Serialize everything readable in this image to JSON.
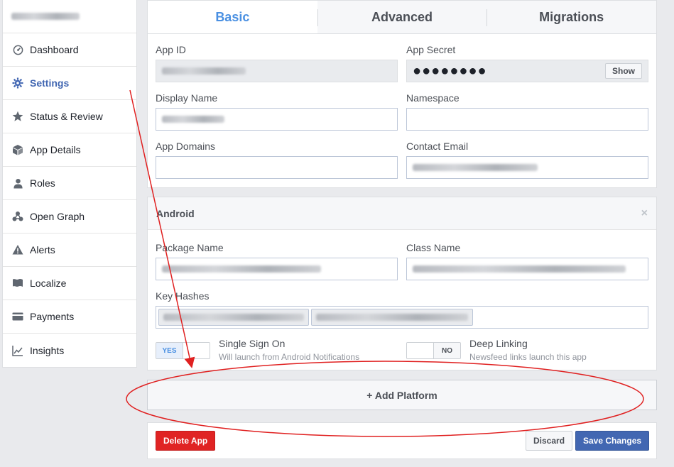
{
  "sidebar": {
    "items": [
      {
        "label": "Dashboard",
        "icon": "dashboard-icon"
      },
      {
        "label": "Settings",
        "icon": "gear-icon",
        "active": true
      },
      {
        "label": "Status & Review",
        "icon": "star-icon"
      },
      {
        "label": "App Details",
        "icon": "cube-icon"
      },
      {
        "label": "Roles",
        "icon": "person-icon"
      },
      {
        "label": "Open Graph",
        "icon": "graph-icon"
      },
      {
        "label": "Alerts",
        "icon": "warning-icon"
      },
      {
        "label": "Localize",
        "icon": "flag-icon"
      },
      {
        "label": "Payments",
        "icon": "card-icon"
      },
      {
        "label": "Insights",
        "icon": "chart-icon"
      }
    ]
  },
  "tabs": [
    {
      "label": "Basic",
      "active": true
    },
    {
      "label": "Advanced"
    },
    {
      "label": "Migrations"
    }
  ],
  "basic": {
    "app_id_label": "App ID",
    "app_secret_label": "App Secret",
    "app_secret_value": "●●●●●●●●",
    "show_label": "Show",
    "display_name_label": "Display Name",
    "namespace_label": "Namespace",
    "app_domains_label": "App Domains",
    "contact_email_label": "Contact Email"
  },
  "android": {
    "title": "Android",
    "close": "×",
    "package_name_label": "Package Name",
    "class_name_label": "Class Name",
    "key_hashes_label": "Key Hashes",
    "sso_toggle_on": "YES",
    "sso_title": "Single Sign On",
    "sso_desc": "Will launch from Android Notifications",
    "deep_toggle_off": "NO",
    "deep_title": "Deep Linking",
    "deep_desc": "Newsfeed links launch this app"
  },
  "add_platform": "+ Add Platform",
  "footer": {
    "delete": "Delete App",
    "discard": "Discard",
    "save": "Save Changes"
  },
  "colors": {
    "accent": "#4267b2",
    "tab_active": "#4a90e2",
    "danger": "#e02424",
    "annotation": "#e02020"
  }
}
